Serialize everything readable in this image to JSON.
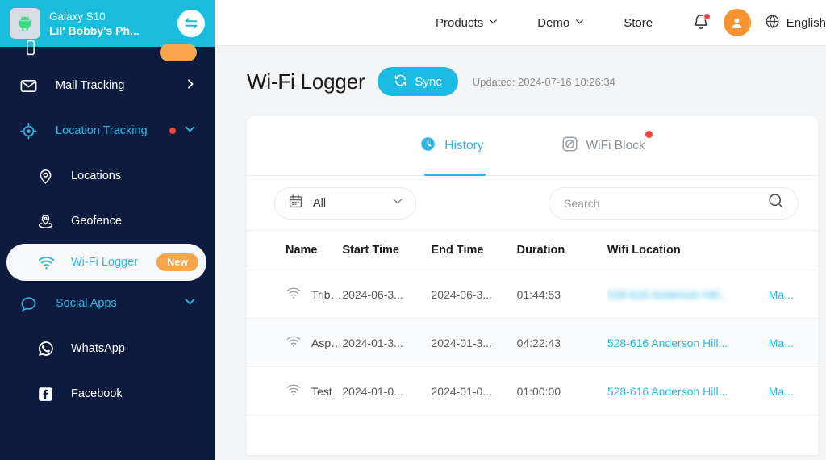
{
  "sidebar": {
    "device": {
      "model": "Galaxy S10",
      "name": "Lil' Bobby's Ph...",
      "os_icon": "android-icon",
      "switch_icon": "switch-device-icon"
    },
    "items": [
      {
        "label": "Mail Tracking",
        "icon": "mail-icon",
        "state": "collapsed",
        "chevron": "chevron-right-icon"
      },
      {
        "label": "Location Tracking",
        "icon": "location-target-icon",
        "state": "expanded",
        "chevron": "chevron-down-icon",
        "dot": true
      },
      {
        "label": "Social Apps",
        "icon": "chat-bubble-icon",
        "state": "expanded",
        "chevron": "chevron-down-icon"
      }
    ],
    "location_children": [
      {
        "label": "Locations",
        "icon": "map-pin-icon",
        "selected": false
      },
      {
        "label": "Geofence",
        "icon": "geofence-icon",
        "selected": false
      },
      {
        "label": "Wi-Fi Logger",
        "icon": "wifi-icon",
        "selected": true,
        "badge": "New"
      }
    ],
    "social_children": [
      {
        "label": "WhatsApp",
        "icon": "whatsapp-icon"
      },
      {
        "label": "Facebook",
        "icon": "facebook-icon"
      }
    ]
  },
  "topbar": {
    "nav": [
      {
        "label": "Products",
        "chevron": "chevron-down-icon"
      },
      {
        "label": "Demo",
        "chevron": "chevron-down-icon"
      },
      {
        "label": "Store",
        "chevron": ""
      }
    ],
    "notification_icon": "bell-icon",
    "has_notification": true,
    "account_icon": "user-avatar-icon",
    "language": "English",
    "language_icon": "globe-icon"
  },
  "page": {
    "title": "Wi-Fi Logger",
    "sync_label": "Sync",
    "sync_icon": "refresh-icon",
    "updated": "Updated: 2024-07-16 10:26:34"
  },
  "tabs": [
    {
      "label": "History",
      "icon": "clock-icon",
      "active": true,
      "dot": false
    },
    {
      "label": "WiFi Block",
      "icon": "block-icon",
      "active": false,
      "dot": true
    }
  ],
  "filters": {
    "date_label": "All",
    "date_icon": "calendar-icon",
    "date_chevron": "chevron-down-icon",
    "search_placeholder": "Search",
    "search_value": "",
    "search_icon": "search-icon"
  },
  "table": {
    "columns": [
      "Name",
      "Start Time",
      "End Time",
      "Duration",
      "Wifi Location",
      ""
    ],
    "rows": [
      {
        "icon": "wifi-icon",
        "name": "Tribbiana'...",
        "start": "2024-06-3...",
        "end": "2024-06-3...",
        "duration": "01:44:53",
        "location": "528-616 Anderson Hill...",
        "location_blurred": true,
        "action": "Ma..."
      },
      {
        "icon": "wifi-icon",
        "name": "Asper's ...",
        "start": "2024-01-3...",
        "end": "2024-01-3...",
        "duration": "04:22:43",
        "location": "528-616 Anderson Hill...",
        "location_blurred": false,
        "action": "Ma..."
      },
      {
        "icon": "wifi-icon",
        "name": "Test",
        "start": "2024-01-0...",
        "end": "2024-01-0...",
        "duration": "01:00:00",
        "location": "528-616 Anderson Hill...",
        "location_blurred": false,
        "action": "Ma..."
      }
    ]
  },
  "colors": {
    "sidebar_bg": "#0d1b3e",
    "device_card": "#19bcdd",
    "accent_cyan": "#2bb8e8",
    "accent_orange": "#f7a64b",
    "avatar_orange": "#f79331",
    "alert_red": "#f9423a",
    "page_bg": "#f4f5f7"
  }
}
